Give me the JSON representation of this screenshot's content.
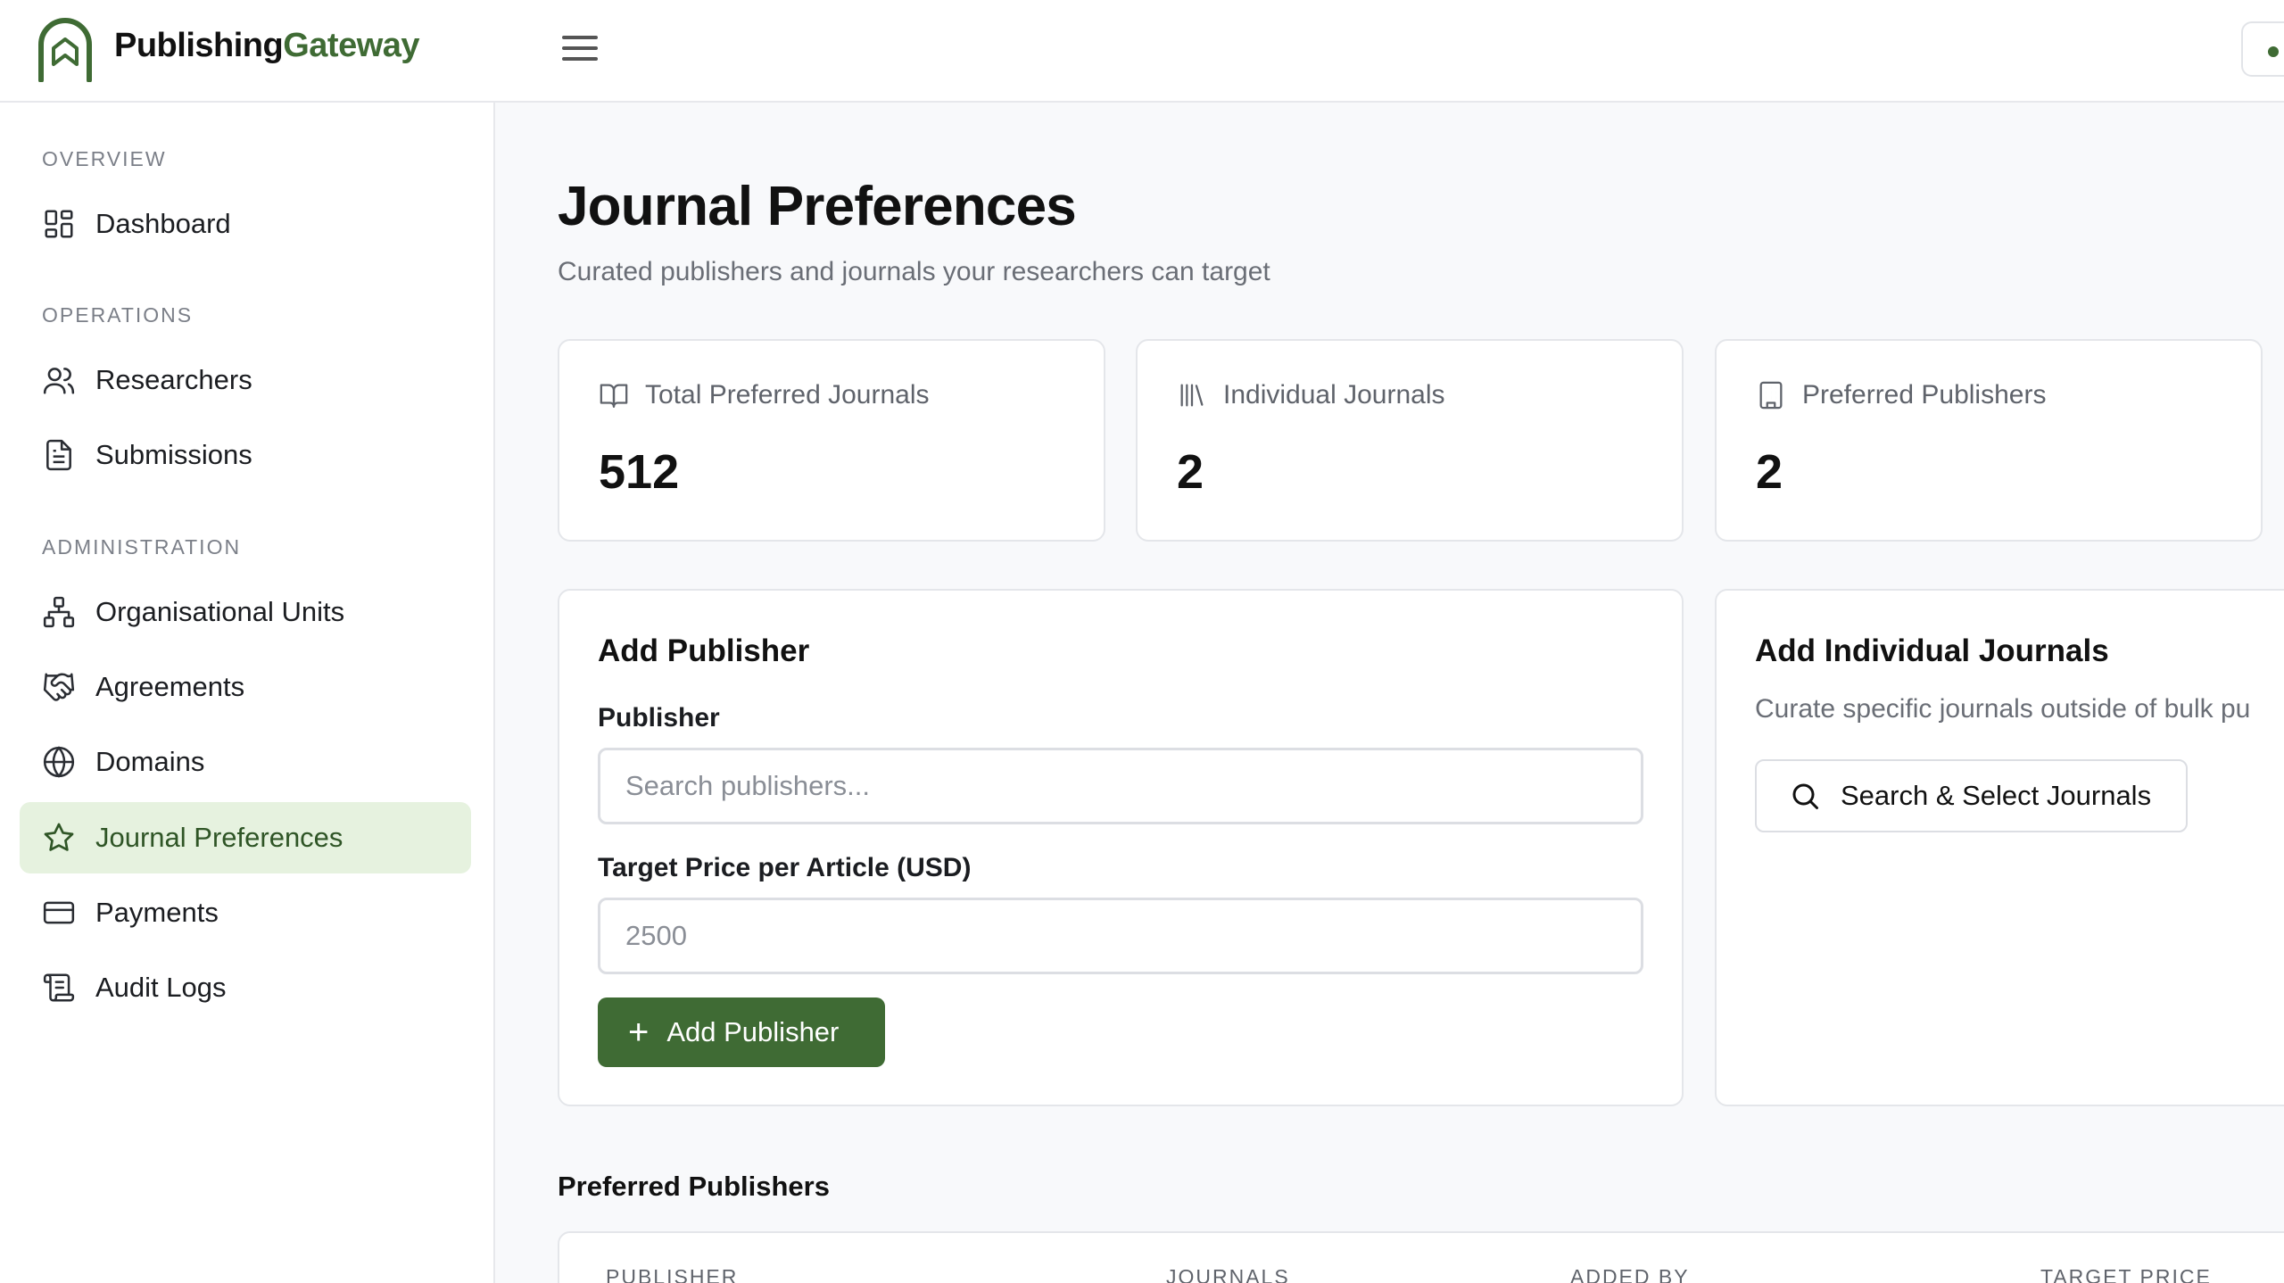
{
  "brand": {
    "name_part1": "Publishing",
    "name_part2": "Gateway",
    "accent_color": "#3f6b34"
  },
  "header": {
    "menu_icon": "hamburger-icon",
    "status_icon": "status-dot-icon"
  },
  "sidebar": {
    "sections": [
      {
        "label": "OVERVIEW"
      },
      {
        "label": "OPERATIONS"
      },
      {
        "label": "ADMINISTRATION"
      }
    ],
    "items": [
      {
        "label": "Dashboard",
        "icon": "dashboard-icon"
      },
      {
        "label": "Researchers",
        "icon": "users-icon"
      },
      {
        "label": "Submissions",
        "icon": "document-icon"
      },
      {
        "label": "Organisational Units",
        "icon": "org-chart-icon"
      },
      {
        "label": "Agreements",
        "icon": "handshake-icon"
      },
      {
        "label": "Domains",
        "icon": "globe-icon"
      },
      {
        "label": "Journal Preferences",
        "icon": "star-icon",
        "active": true
      },
      {
        "label": "Payments",
        "icon": "credit-card-icon"
      },
      {
        "label": "Audit Logs",
        "icon": "scroll-icon"
      }
    ]
  },
  "main": {
    "title": "Journal Preferences",
    "subtitle": "Curated publishers and journals your researchers can target",
    "stats": [
      {
        "label": "Total Preferred Journals",
        "value": "512",
        "icon": "book-open-icon"
      },
      {
        "label": "Individual Journals",
        "value": "2",
        "icon": "library-icon"
      },
      {
        "label": "Preferred Publishers",
        "value": "2",
        "icon": "building-icon"
      }
    ],
    "add_publisher": {
      "title": "Add Publisher",
      "publisher_label": "Publisher",
      "publisher_placeholder": "Search publishers...",
      "price_label": "Target Price per Article (USD)",
      "price_placeholder": "2500",
      "button_label": "Add Publisher"
    },
    "add_journals": {
      "title": "Add Individual Journals",
      "description": "Curate specific journals outside of bulk pu",
      "button_label": "Search & Select Journals"
    },
    "preferred_publishers": {
      "heading": "Preferred Publishers",
      "columns": [
        "PUBLISHER",
        "JOURNALS",
        "ADDED BY",
        "TARGET PRICE"
      ]
    }
  }
}
